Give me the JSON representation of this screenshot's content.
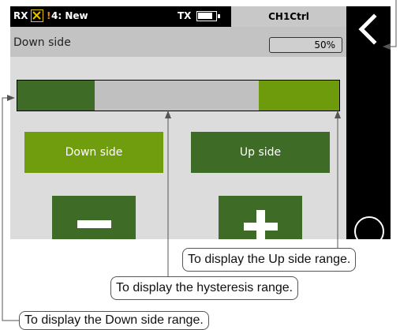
{
  "status_bar": {
    "rx_label": "RX",
    "model_label": "4: New",
    "tx_label": "TX",
    "screen_title": "CH1Ctrl",
    "battery_level": 0.7,
    "warning_color": "#f08a00"
  },
  "setting": {
    "label": "Down side",
    "value": "50%"
  },
  "range_bar": {
    "down_range": 0.24,
    "up_range": 0.25,
    "down_color": "#3e6b25",
    "up_color": "#6e9b0c",
    "hysteresis_color": "#c0c0c0"
  },
  "buttons": {
    "down_side": "Down side",
    "up_side": "Up side",
    "selected": "Down side"
  },
  "callouts": {
    "up": "To display the Up side range.",
    "hysteresis": "To display the hysteresis range.",
    "down": "To display the Down side range."
  },
  "icons": {
    "back": "chevron-left-icon",
    "minus": "minus-icon",
    "plus": "plus-icon",
    "warning": "warning-icon",
    "battery": "battery-icon",
    "receiver_off": "x-box-icon"
  }
}
